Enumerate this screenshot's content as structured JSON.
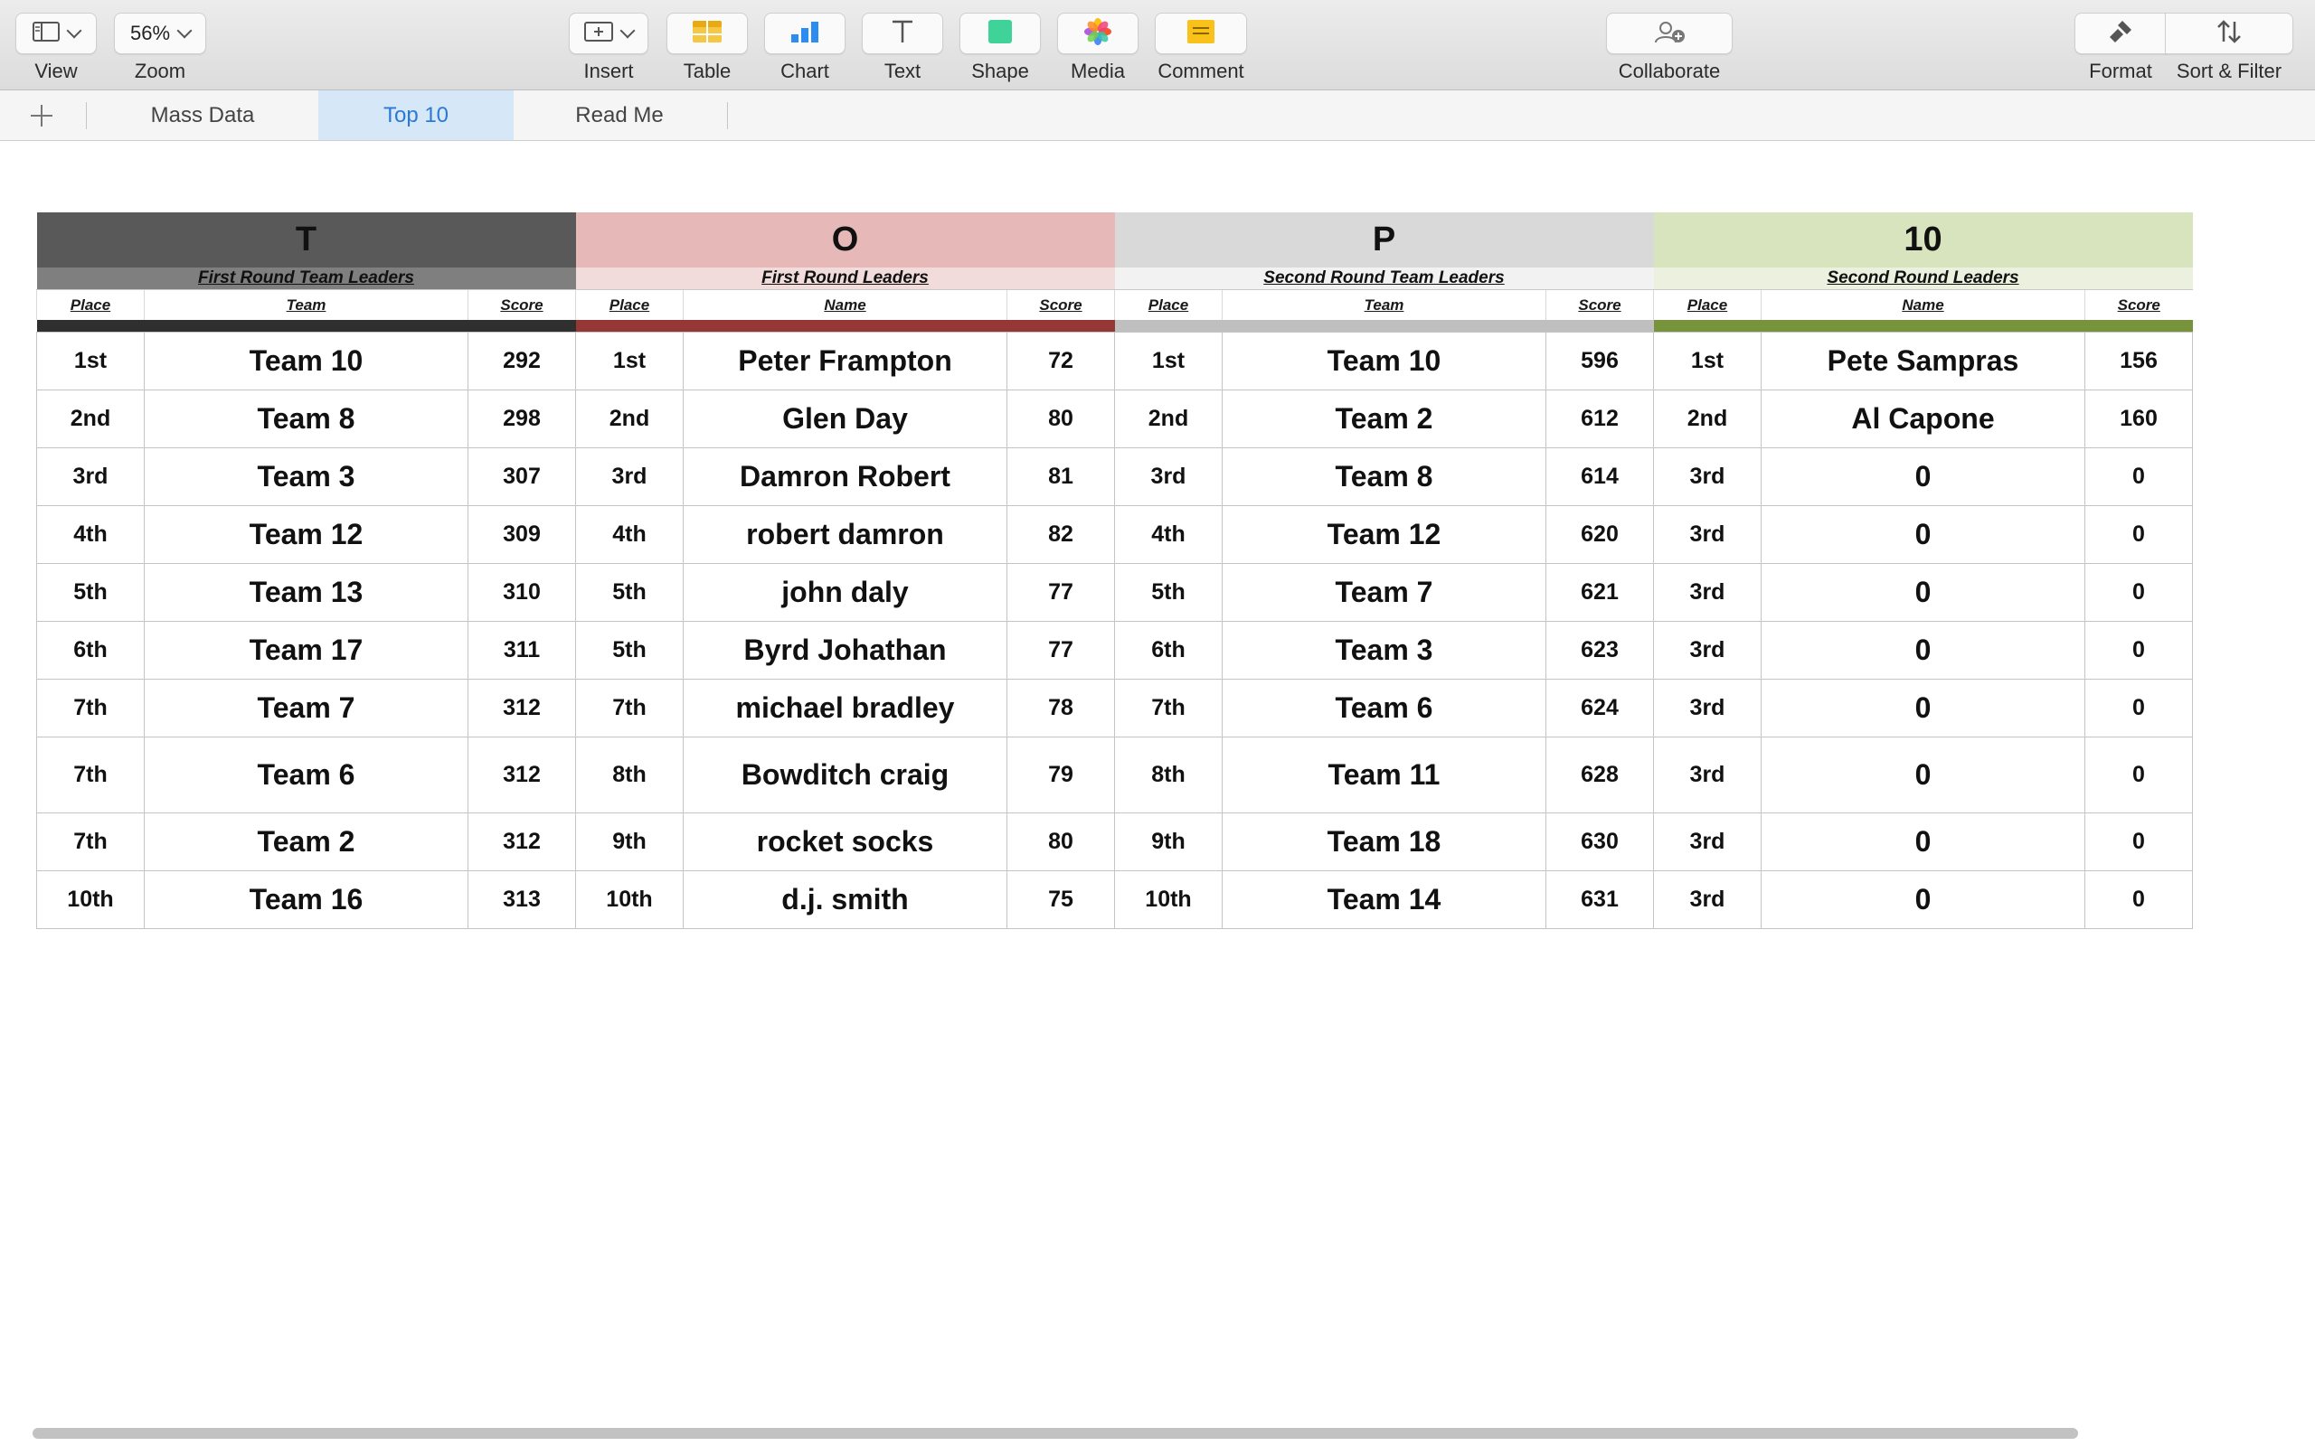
{
  "toolbar": {
    "view_label": "View",
    "zoom_value": "56%",
    "zoom_label": "Zoom",
    "insert_label": "Insert",
    "table_label": "Table",
    "chart_label": "Chart",
    "text_label": "Text",
    "shape_label": "Shape",
    "media_label": "Media",
    "comment_label": "Comment",
    "collaborate_label": "Collaborate",
    "format_label": "Format",
    "sort_filter_label": "Sort & Filter"
  },
  "sheet_tabs": [
    "Mass Data",
    "Top 10",
    "Read Me"
  ],
  "active_tab": "Top 10",
  "table": {
    "sections": [
      {
        "letter": "T",
        "subtitle": "First Round Team Leaders",
        "columns": [
          "Place",
          "Team",
          "Score"
        ],
        "band_color": "#595959",
        "sub_color": "#7f7f7f",
        "bar_color": "#2f2f2f",
        "rows": [
          [
            "1st",
            "Team 10",
            "292"
          ],
          [
            "2nd",
            "Team 8",
            "298"
          ],
          [
            "3rd",
            "Team 3",
            "307"
          ],
          [
            "4th",
            "Team 12",
            "309"
          ],
          [
            "5th",
            "Team 13",
            "310"
          ],
          [
            "6th",
            "Team 17",
            "311"
          ],
          [
            "7th",
            "Team 7",
            "312"
          ],
          [
            "7th",
            "Team 6",
            "312"
          ],
          [
            "7th",
            "Team 2",
            "312"
          ],
          [
            "10th",
            "Team 16",
            "313"
          ]
        ]
      },
      {
        "letter": "O",
        "subtitle": "First Round Leaders",
        "columns": [
          "Place",
          "Name",
          "Score"
        ],
        "band_color": "#e6b8b7",
        "sub_color": "#f2dcdb",
        "bar_color": "#953735",
        "rows": [
          [
            "1st",
            "Peter Frampton",
            "72"
          ],
          [
            "2nd",
            "Glen Day",
            "80"
          ],
          [
            "3rd",
            "Damron Robert",
            "81"
          ],
          [
            "4th",
            "robert damron",
            "82"
          ],
          [
            "5th",
            "john daly",
            "77"
          ],
          [
            "5th",
            "Byrd Johathan",
            "77"
          ],
          [
            "7th",
            "michael bradley",
            "78"
          ],
          [
            "8th",
            "Bowditch craig",
            "79"
          ],
          [
            "9th",
            "rocket socks",
            "80"
          ],
          [
            "10th",
            "d.j. smith",
            "75"
          ]
        ]
      },
      {
        "letter": "P",
        "subtitle": "Second Round Team Leaders",
        "columns": [
          "Place",
          "Team",
          "Score"
        ],
        "band_color": "#d9d9d9",
        "sub_color": "#f2f2f2",
        "bar_color": "#bfbfbf",
        "rows": [
          [
            "1st",
            "Team 10",
            "596"
          ],
          [
            "2nd",
            "Team 2",
            "612"
          ],
          [
            "3rd",
            "Team 8",
            "614"
          ],
          [
            "4th",
            "Team 12",
            "620"
          ],
          [
            "5th",
            "Team 7",
            "621"
          ],
          [
            "6th",
            "Team 3",
            "623"
          ],
          [
            "7th",
            "Team 6",
            "624"
          ],
          [
            "8th",
            "Team 11",
            "628"
          ],
          [
            "9th",
            "Team 18",
            "630"
          ],
          [
            "10th",
            "Team 14",
            "631"
          ]
        ]
      },
      {
        "letter": "10",
        "subtitle": "Second Round Leaders",
        "columns": [
          "Place",
          "Name",
          "Score"
        ],
        "band_color": "#d7e4bd",
        "sub_color": "#ebf1de",
        "bar_color": "#77933c",
        "rows": [
          [
            "1st",
            "Pete Sampras",
            "156"
          ],
          [
            "2nd",
            "Al Capone",
            "160"
          ],
          [
            "3rd",
            "0",
            "0"
          ],
          [
            "3rd",
            "0",
            "0"
          ],
          [
            "3rd",
            "0",
            "0"
          ],
          [
            "3rd",
            "0",
            "0"
          ],
          [
            "3rd",
            "0",
            "0"
          ],
          [
            "3rd",
            "0",
            "0"
          ],
          [
            "3rd",
            "0",
            "0"
          ],
          [
            "3rd",
            "0",
            "0"
          ]
        ]
      }
    ]
  }
}
